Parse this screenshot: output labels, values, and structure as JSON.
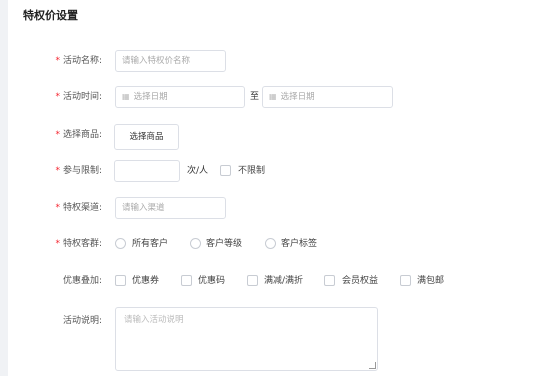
{
  "page": {
    "title": "特权价设置"
  },
  "form": {
    "name": {
      "label": "活动名称:",
      "placeholder": "请输入特权价名称",
      "required": true
    },
    "time": {
      "label": "活动时间:",
      "start_placeholder": "选择日期",
      "separator": "至",
      "end_placeholder": "选择日期",
      "required": true
    },
    "goods": {
      "label": "选择商品:",
      "button": "选择商品",
      "required": true
    },
    "limit": {
      "label": "参与限制:",
      "value": "",
      "unit": "次/人",
      "unlimited_label": "不限制",
      "required": true
    },
    "channel": {
      "label": "特权渠道:",
      "placeholder": "请输入渠道",
      "required": true
    },
    "audience": {
      "label": "特权客群:",
      "options": [
        "所有客户",
        "客户等级",
        "客户标签"
      ],
      "required": true
    },
    "stacking": {
      "label": "优惠叠加:",
      "options": [
        "优惠券",
        "优惠码",
        "满减/满折",
        "会员权益",
        "满包邮"
      ]
    },
    "description": {
      "label": "活动说明:",
      "placeholder": "请输入活动说明"
    }
  },
  "icons": {
    "calendar": "calendar-icon"
  },
  "colors": {
    "required_mark": "#f5222d",
    "border": "#dcdfe6",
    "sidebar": "#f0f2f5"
  }
}
